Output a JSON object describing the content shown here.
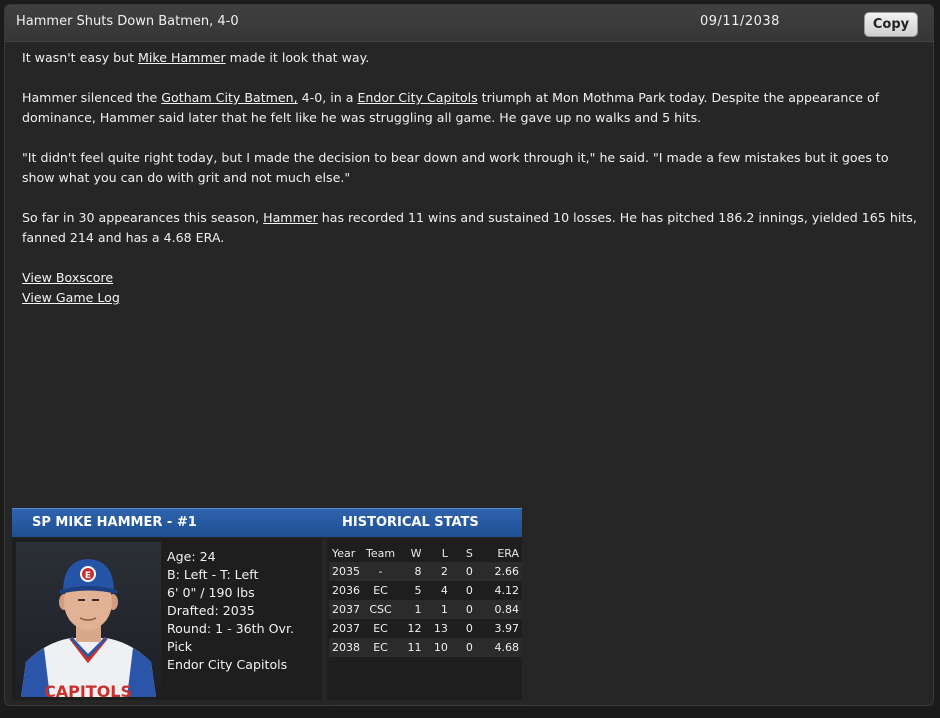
{
  "window": {
    "title": "Hammer Shuts Down Batmen, 4-0",
    "date": "09/11/2038",
    "copy_label": "Copy"
  },
  "article": {
    "p1": {
      "before": "It wasn't easy but ",
      "link": "Mike Hammer",
      "after": " made it look that way."
    },
    "p2": {
      "t1": "Hammer silenced the ",
      "link1": "Gotham City Batmen,",
      "t2": " 4-0, in a ",
      "link2": "Endor City Capitols",
      "t3": " triumph at Mon Mothma Park today. Despite the appearance of dominance, Hammer said later that he felt like he was struggling all game. He gave up no walks and 5 hits."
    },
    "p3": "\"It didn't feel quite right today, but I made the decision to bear down and work through it,\" he said. \"I made a few mistakes but it goes to show what you can do with grit and not much else.\"",
    "p4": {
      "t1": "So far in 30 appearances this season, ",
      "link": "Hammer",
      "t2": " has recorded 11 wins and sustained 10 losses. He has pitched 186.2 innings, yielded 165 hits, fanned 214 and has a 4.68 ERA."
    },
    "view_boxscore": "View Boxscore",
    "view_game_log": "View Game Log"
  },
  "card": {
    "name": "SP MIKE HAMMER - #1",
    "historical_title": "HISTORICAL STATS",
    "accent_color": "#2a5da6",
    "bio": {
      "age": "Age: 24",
      "bats_throws": "B: Left - T: Left",
      "height_weight": "6' 0\" / 190 lbs",
      "drafted": "Drafted: 2035",
      "round": "Round: 1 - 36th Ovr. Pick",
      "team": "Endor City Capitols"
    },
    "photo": {
      "icon": "player-portrait",
      "jersey_text": "CAPITOLS",
      "cap_logo": "E"
    },
    "stats": {
      "headers": [
        "Year",
        "Team",
        "W",
        "L",
        "S",
        "ERA"
      ],
      "rows": [
        [
          "2035",
          "-",
          "8",
          "2",
          "0",
          "2.66"
        ],
        [
          "2036",
          "EC",
          "5",
          "4",
          "0",
          "4.12"
        ],
        [
          "2037",
          "CSC",
          "1",
          "1",
          "0",
          "0.84"
        ],
        [
          "2037",
          "EC",
          "12",
          "13",
          "0",
          "3.97"
        ],
        [
          "2038",
          "EC",
          "11",
          "10",
          "0",
          "4.68"
        ]
      ]
    }
  }
}
